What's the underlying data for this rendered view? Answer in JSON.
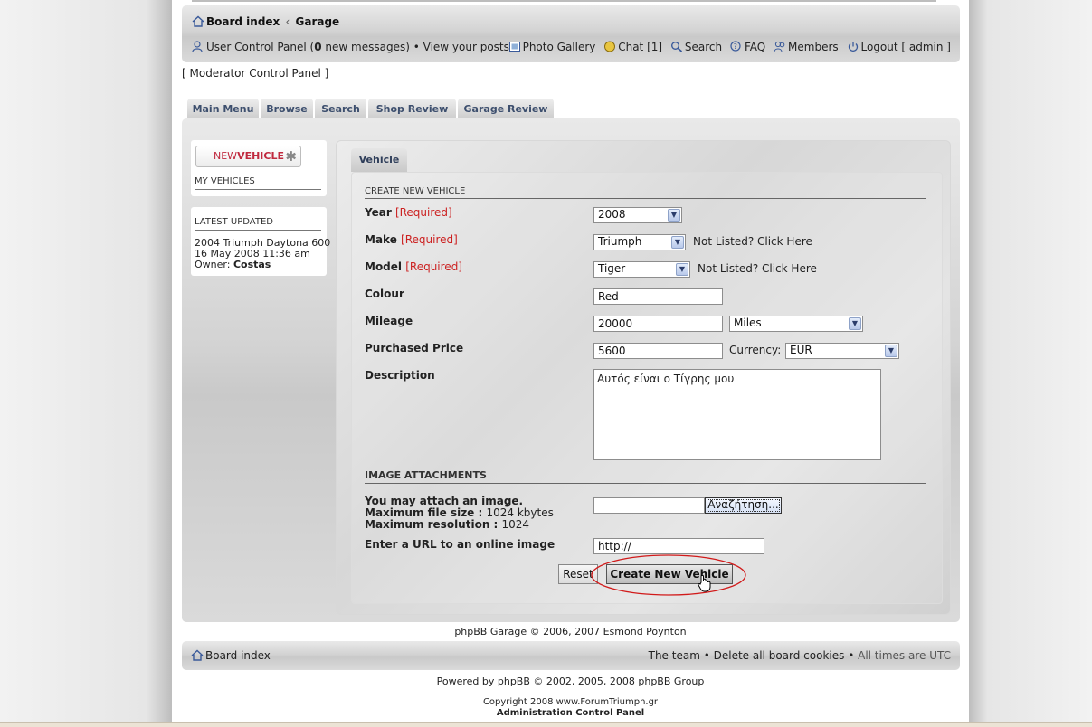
{
  "header": {
    "breadcrumb": {
      "home": "Board index",
      "separator": "‹",
      "current": "Garage"
    },
    "ucp": "User Control Panel (",
    "new_count": "0",
    "ucp_tail": " new messages)",
    "bullet": "•",
    "view_posts": "View your posts",
    "photo_gallery": "Photo Gallery",
    "chat": "Chat [1]",
    "search": "Search",
    "faq": "FAQ",
    "members": "Members",
    "logout": "Logout [ admin ]"
  },
  "moderator_link": "[ Moderator Control Panel ]",
  "tabs": [
    "Main Menu",
    "Browse",
    "Search",
    "Shop Review",
    "Garage Review"
  ],
  "sidebar": {
    "new_vehicle_new": "NEW",
    "new_vehicle_vehicle": "VEHICLE",
    "new_vehicle_star": "✱",
    "my_vehicles": "MY VEHICLES",
    "latest_updated": "LATEST UPDATED",
    "latest_vehicle": "2004 Triumph Daytona 600",
    "latest_date": "16 May 2008 11:36 am",
    "owner_label": "Owner:",
    "owner_name": "Costas"
  },
  "form": {
    "tab": "Vehicle",
    "section_title": "CREATE NEW VEHICLE",
    "required_tag": "[Required]",
    "year_label": "Year",
    "year_value": "2008",
    "make_label": "Make",
    "make_value": "Triumph",
    "not_listed": "Not Listed? Click",
    "here": "Here",
    "model_label": "Model",
    "model_value": "Tiger",
    "colour_label": "Colour",
    "colour_value": "Red",
    "mileage_label": "Mileage",
    "mileage_value": "20000",
    "mileage_unit": "Miles",
    "price_label": "Purchased Price",
    "price_value": "5600",
    "currency_label": "Currency:",
    "currency_value": "EUR",
    "description_label": "Description",
    "description_value": "Αυτός είναι ο Τίγρης μου",
    "attachments_title": "IMAGE ATTACHMENTS",
    "attach_line1": "You may attach an image.",
    "max_size_label": "Maximum file size :",
    "max_size_value": "1024 kbytes",
    "max_res_label": "Maximum resolution :",
    "max_res_value": "1024",
    "browse_button": "Αναζήτηση...",
    "url_label": "Enter a URL to an online image",
    "url_value": "http://",
    "reset_button": "Reset",
    "submit_button": "Create New Vehicle"
  },
  "footer": {
    "garage_copy": "phpBB Garage © 2006, 2007 Esmond Poynton",
    "board_index": "Board index",
    "team": "The team",
    "delete_cookies": "Delete all board cookies",
    "times": "All times are UTC",
    "powered_by": "Powered by",
    "phpbb": "phpBB",
    "phpbb_copy": "© 2002, 2005, 2008 phpBB Group",
    "site_copy": "Copyright 2008 www.ForumTriumph.gr",
    "acp": "Administration Control Panel"
  },
  "colors": {
    "required": "#cc2222",
    "tab_text": "#3d4f6e",
    "highlight_ellipse": "#d11a1a"
  },
  "icons": [
    "home-icon",
    "user-icon",
    "gallery-icon",
    "chat-icon",
    "search-icon",
    "faq-icon",
    "members-icon",
    "logout-icon",
    "star-icon",
    "dropdown-arrow-icon",
    "hand-cursor-icon"
  ]
}
